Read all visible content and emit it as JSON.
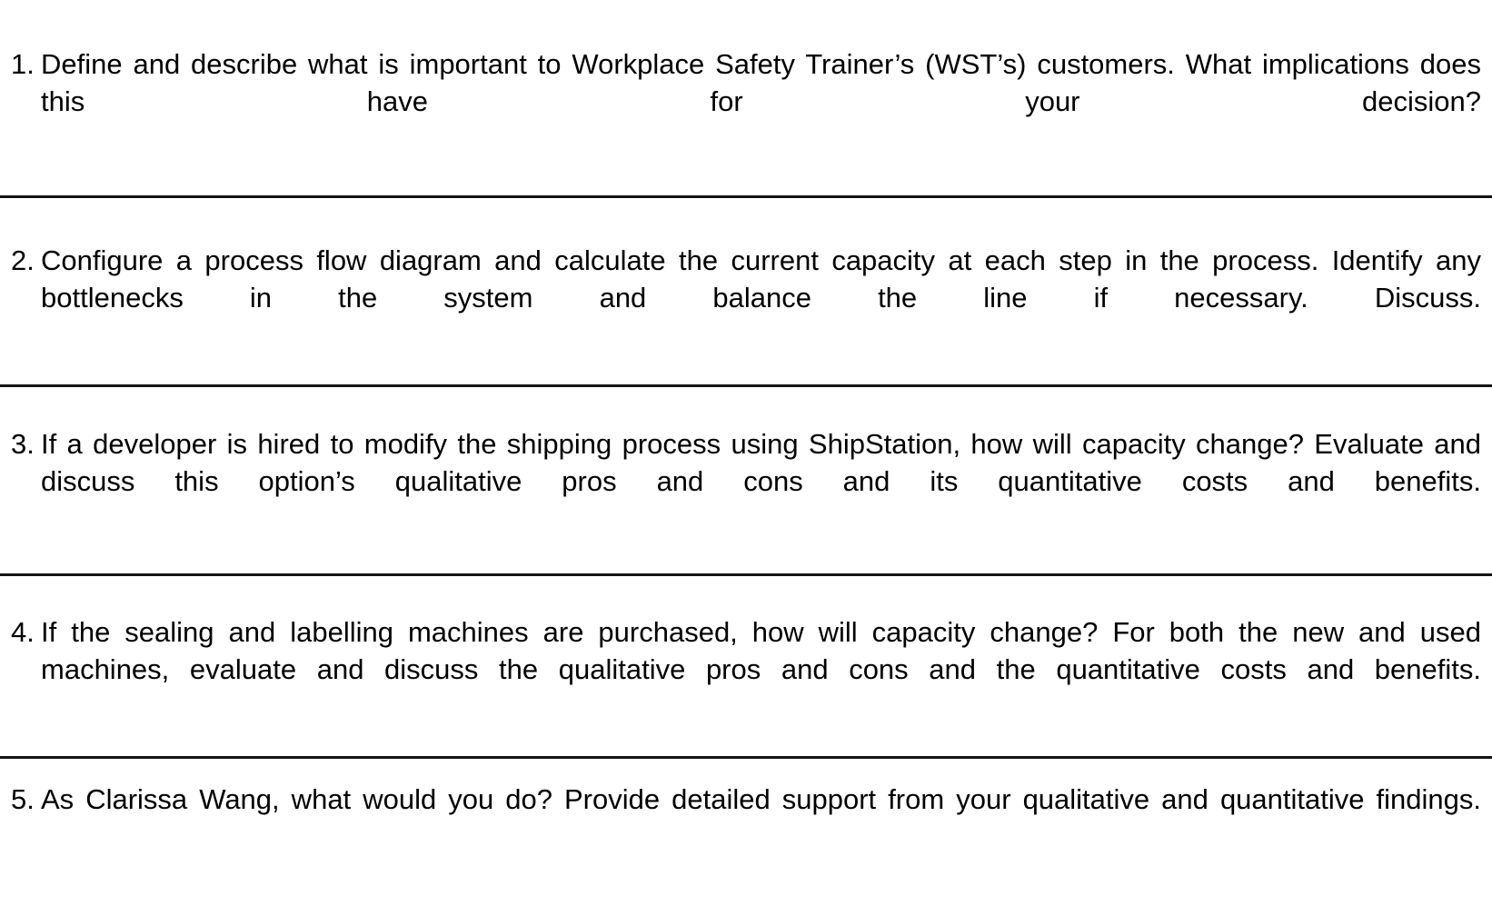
{
  "document": {
    "type": "numbered-question-list",
    "background_color": "#ffffff",
    "text_color": "#000000",
    "divider_color": "#141414",
    "questions": [
      {
        "number": "1.",
        "text": "Define and describe what is important to Workplace Safety Trainer’s (WST’s) customers. What implications does this have for your decision?"
      },
      {
        "number": "2.",
        "text": "Configure a process flow diagram and calculate the current capacity at each step in the process. Identify any bottlenecks in the system and balance the line if necessary. Discuss."
      },
      {
        "number": "3.",
        "text": "If a developer is hired to modify the shipping process using ShipStation, how will capacity change? Evaluate and discuss this option’s qualitative pros and cons and its quantitative costs and benefits."
      },
      {
        "number": "4.",
        "text": "If the sealing and labelling machines are purchased, how will capacity change? For both the new and used machines, evaluate and discuss the qualitative pros and cons and the quantitative costs and benefits."
      },
      {
        "number": "5.",
        "text": "As Clarissa Wang, what would you do? Provide detailed support from your qualitative and quantitative findings."
      }
    ]
  }
}
